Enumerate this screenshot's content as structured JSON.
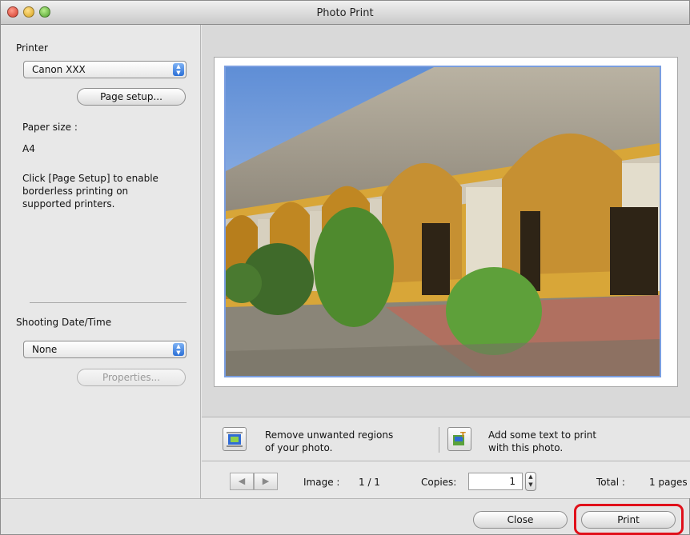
{
  "window": {
    "title": "Photo Print"
  },
  "sidebar": {
    "printer_label": "Printer",
    "printer_value": "Canon XXX",
    "page_setup_button": "Page setup...",
    "paper_size_label": "Paper size :",
    "paper_size_value": "A4",
    "hint_line1": "Click [Page Setup] to enable",
    "hint_line2": "borderless printing on",
    "hint_line3": "supported printers.",
    "shooting_label": "Shooting Date/Time",
    "shooting_value": "None",
    "properties_button": "Properties..."
  },
  "actions": {
    "trim_line1": "Remove unwanted regions",
    "trim_line2": "of your photo.",
    "text_line1": "Add some text to print",
    "text_line2": "with this photo."
  },
  "nav": {
    "image_label": "Image :",
    "image_value": "1 / 1",
    "copies_label": "Copies:",
    "copies_value": "1",
    "total_label": "Total :",
    "total_value": "1 pages"
  },
  "footer": {
    "close_button": "Close",
    "print_button": "Print"
  },
  "colors": {
    "highlight": "#e0101a",
    "photo_border": "#7a9ee0"
  }
}
